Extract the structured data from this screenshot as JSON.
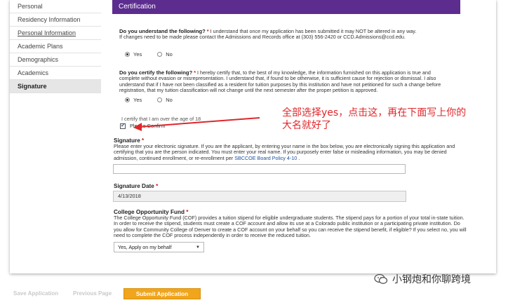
{
  "sidebar": {
    "items": [
      {
        "label": "Personal"
      },
      {
        "label": "Residency Information"
      },
      {
        "label": "Personal Information"
      },
      {
        "label": "Academic Plans"
      },
      {
        "label": "Demographics"
      },
      {
        "label": "Academics"
      },
      {
        "label": "Signature"
      }
    ]
  },
  "certification": {
    "header": "Certification",
    "q1": {
      "title": "Do you understand the following?",
      "required": "*",
      "text": " I understand that once my application has been submitted it may NOT be altered in any way.",
      "text2": "If changes need to be made please contact the Admissions and Records office at (303) 556-2420 or CCD.Admissions@ccd.edu.",
      "yes": "Yes",
      "no": "No"
    },
    "q2": {
      "title": "Do you certify the following?",
      "required": "*",
      "text": " I hereby certify that, to the best of my knowledge, the information furnished on this application is true and complete without evasion or misrepresentation. I understand that, if found to be otherwise, it is sufficient cause for rejection or dismissal. I also understand that if I have not been classified as a resident for tuition purposes by this institution and have not petitioned for such a change before registration, that my tuition classification will not change until the next semester after the proper petition is approved.",
      "yes": "Yes",
      "no": "No"
    },
    "age_label": "I certify that I am over the age of 18",
    "age_checkbox_label": "Please Confirm"
  },
  "annotation": {
    "text": "全部选择yes，点击这，再在下面写上你的大名就好了",
    "color": "#e0262b"
  },
  "signature": {
    "title": "Signature",
    "required": "*",
    "text": "Please enter your electronic signature. If you are the applicant, by entering your name in the box below, you are electronically signing this application and certifying that you are the person indicated. You must enter your real name. If you purposely enter false or misleading information, you may be denied admission, continued enrollment, or re-enrollment per ",
    "link": "SBCCOE Board Policy 4-10",
    "tail": " .",
    "value": ""
  },
  "signature_date": {
    "title": "Signature Date",
    "required": "*",
    "value": "4/13/2018"
  },
  "cof": {
    "title": "College Opportunity Fund",
    "required": "*",
    "text": "The College Opportunity Fund (COF) provides a tuition stipend for eligible undergraduate students. The stipend pays for a portion of your total in-state tuition. In order to receive the stipend, students must create a COF account and allow its use at a Colorado public institution or a participating private institution. Do you allow for Community College of Denver to create a COF account on your behalf so you can receive the stipend benefit, if eligible? If you select no, you will need to complete the COF process independently in order to receive the reduced tuition.",
    "selected": "Yes, Apply on my behalf"
  },
  "actions": {
    "save": "Save Application",
    "previous": "Previous Page",
    "submit": "Submit Application"
  },
  "watermark": {
    "text": "小钢炮和你聊跨境"
  },
  "colors": {
    "header_purple": "#5c2d8f",
    "submit_orange": "#f0a51c",
    "required_red": "#c0221b",
    "annotation_red": "#e0262b"
  }
}
